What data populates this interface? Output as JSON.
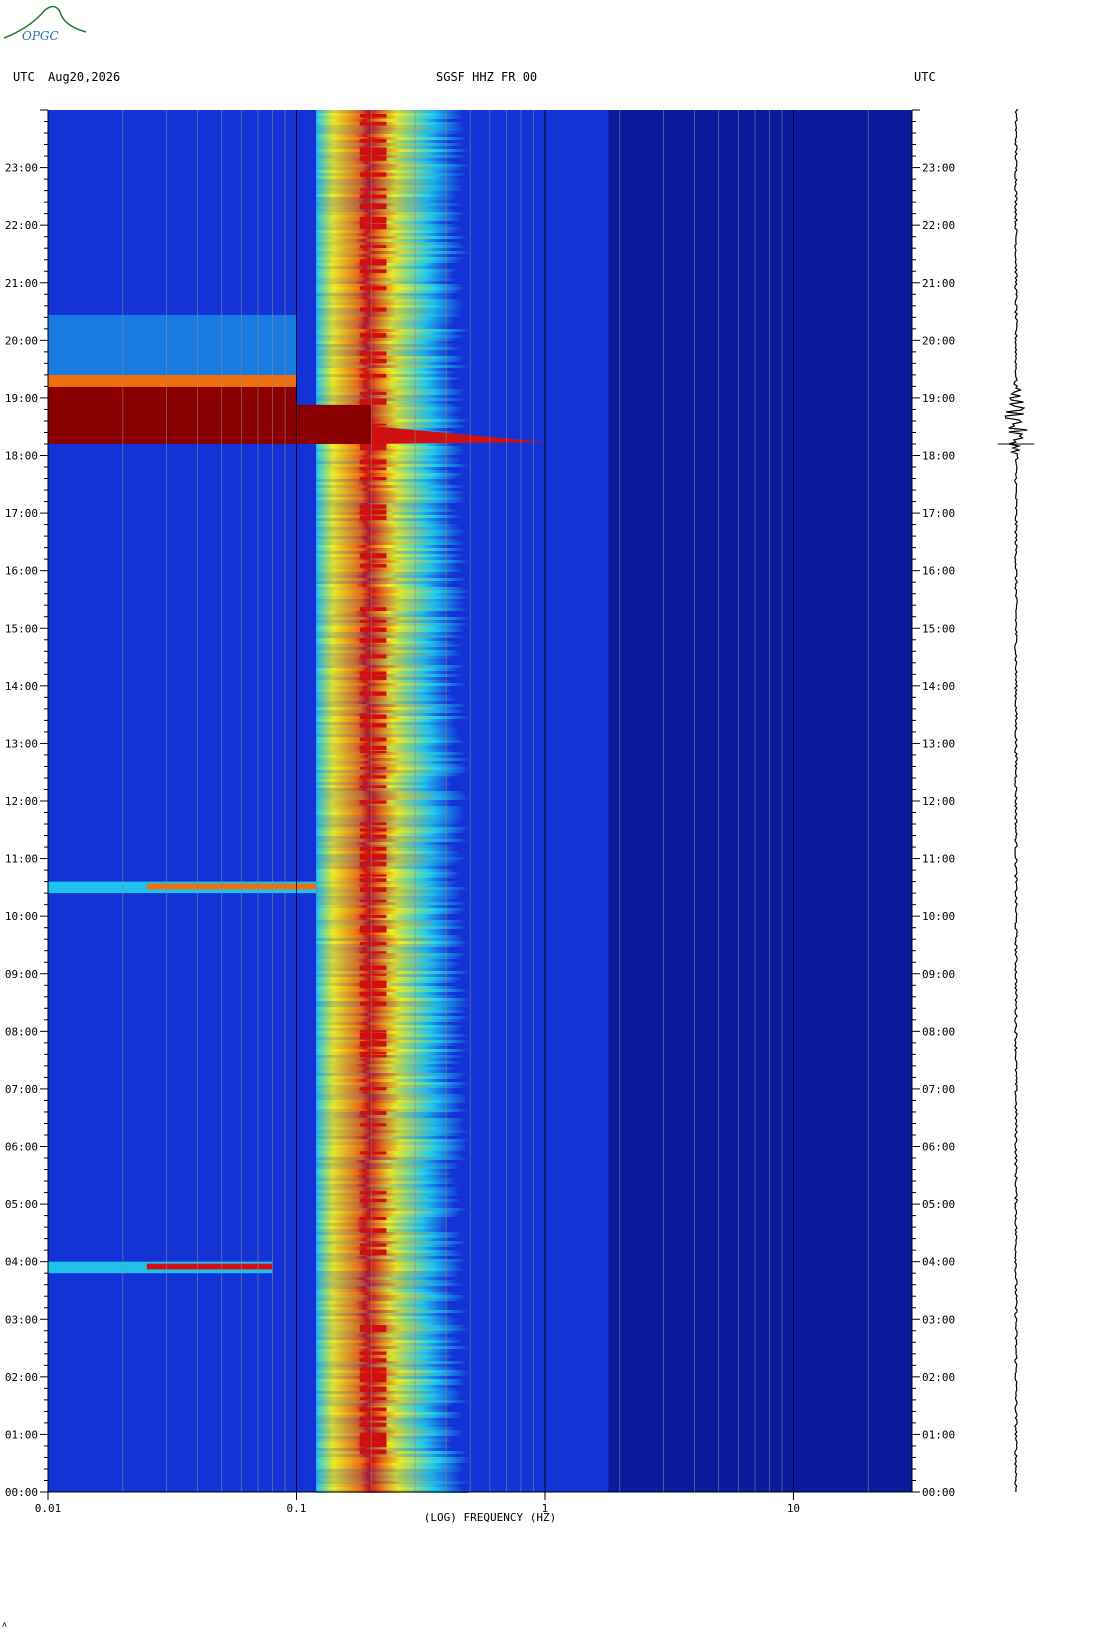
{
  "header": {
    "left_label": "UTC",
    "date": "Aug20,2026",
    "station": "SGSF HHZ FR 00",
    "right_label": "UTC"
  },
  "logo": {
    "text": "OPGC",
    "color": "#2a7a3a"
  },
  "corner_mark": "ʌ",
  "chart_data": {
    "type": "heatmap",
    "xlabel": "(LOG) FREQUENCY (HZ)",
    "x_scale": "log",
    "xlim": [
      0.01,
      30
    ],
    "x_tick_labels": [
      {
        "value": 0.01,
        "label": "0.01"
      },
      {
        "value": 0.1,
        "label": "0.1"
      },
      {
        "value": 1,
        "label": "1"
      },
      {
        "value": 10,
        "label": "10"
      }
    ],
    "y_tick_labels": [
      "00:00",
      "01:00",
      "02:00",
      "03:00",
      "04:00",
      "05:00",
      "06:00",
      "07:00",
      "08:00",
      "09:00",
      "10:00",
      "11:00",
      "12:00",
      "13:00",
      "14:00",
      "15:00",
      "16:00",
      "17:00",
      "18:00",
      "19:00",
      "20:00",
      "21:00",
      "22:00",
      "23:00"
    ],
    "ylim_hours": [
      0,
      24
    ],
    "colors": {
      "background": "#0a1a9c",
      "low": "#1433d6",
      "cyan": "#20d0f0",
      "yellow": "#f0f020",
      "orange": "#f07010",
      "red": "#d01010",
      "dark_red": "#8a0000"
    },
    "microseism_band_hz": [
      0.15,
      0.35
    ],
    "events": [
      {
        "start_hour": 18.2,
        "end_hour": 19.4,
        "max_freq_hz": 1.0,
        "level": "strong"
      },
      {
        "start_hour": 10.4,
        "end_hour": 10.6,
        "max_freq_hz": 0.12,
        "level": "moderate"
      },
      {
        "start_hour": 3.8,
        "end_hour": 4.0,
        "max_freq_hz": 0.08,
        "level": "moderate"
      }
    ],
    "seismogram_event_hour": 18.6
  }
}
